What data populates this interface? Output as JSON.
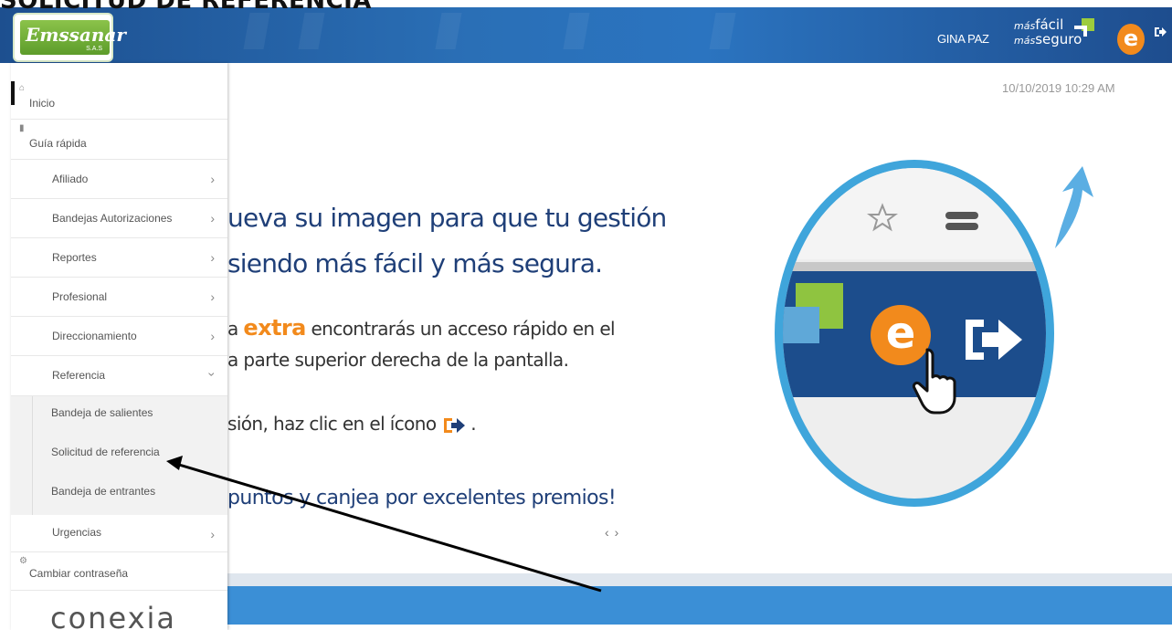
{
  "document": {
    "title": "SOLICITUD DE REFERENCIA"
  },
  "header": {
    "logo_text": "Emssanar",
    "logo_sub": "S.A.S",
    "user_name": "GINA PAZ",
    "brand_line1_prefix": "más",
    "brand_line1": "fácil",
    "brand_line2_prefix": "más",
    "brand_line2": "seguro"
  },
  "sidebar": {
    "items": [
      {
        "label": "Inicio",
        "icon": "home-icon"
      },
      {
        "label": "Guía rápida",
        "icon": "book-icon"
      },
      {
        "label": "Afiliado"
      },
      {
        "label": "Bandejas Autorizaciones"
      },
      {
        "label": "Reportes"
      },
      {
        "label": "Profesional"
      },
      {
        "label": "Direccionamiento"
      },
      {
        "label": "Referencia"
      },
      {
        "label": "Urgencias"
      },
      {
        "label": "Cambiar contraseña",
        "icon": "gear-icon"
      }
    ],
    "submenu": [
      {
        "label": "Bandeja de salientes"
      },
      {
        "label": "Solicitud de referencia"
      },
      {
        "label": "Bandeja de entrantes"
      }
    ],
    "footer_logo": "conexia"
  },
  "main": {
    "datetime": "10/10/2019 10:29 AM",
    "slide": {
      "line1": "ueva su imagen para que tu gestión",
      "line2": "siendo más fácil y más segura.",
      "line3_prefix": "a ",
      "line3_highlight": "extra",
      "line3_suffix": " encontrarás un acceso rápido en el",
      "line4": "a parte superior derecha de la pantalla.",
      "line5": "sión, haz clic en el ícono",
      "line5_end": " .",
      "line6": "puntos y canjea por excelentes premios!",
      "nav_prev": "‹",
      "nav_next": "›",
      "illustration_letter": "e"
    }
  },
  "colors": {
    "header_blue": "#2a6fb6",
    "accent_orange": "#f28a1c",
    "accent_green": "#8fc440",
    "circle_blue": "#3fa5db",
    "text_navy": "#1f3f78"
  }
}
